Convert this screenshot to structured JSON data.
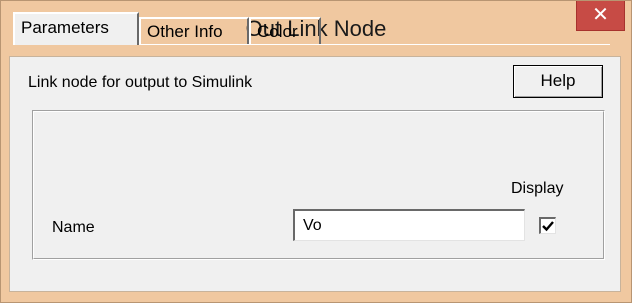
{
  "window": {
    "title": "Out Link Node",
    "close_glyph": "✕"
  },
  "tabs": [
    {
      "label": "Parameters",
      "active": true
    },
    {
      "label": "Other Info",
      "active": false
    },
    {
      "label": "Color",
      "active": false
    }
  ],
  "parameters": {
    "description": "Link node for output to Simulink",
    "help_label": "Help",
    "display_label": "Display",
    "name_label": "Name",
    "name_value": "Vo",
    "display_checked": true
  },
  "colors": {
    "title_bar": "#f0c8a0",
    "close_button": "#c74b45",
    "dialog_face": "#f0f0f0"
  },
  "icons": {
    "close": "close-icon",
    "check": "check-icon"
  }
}
